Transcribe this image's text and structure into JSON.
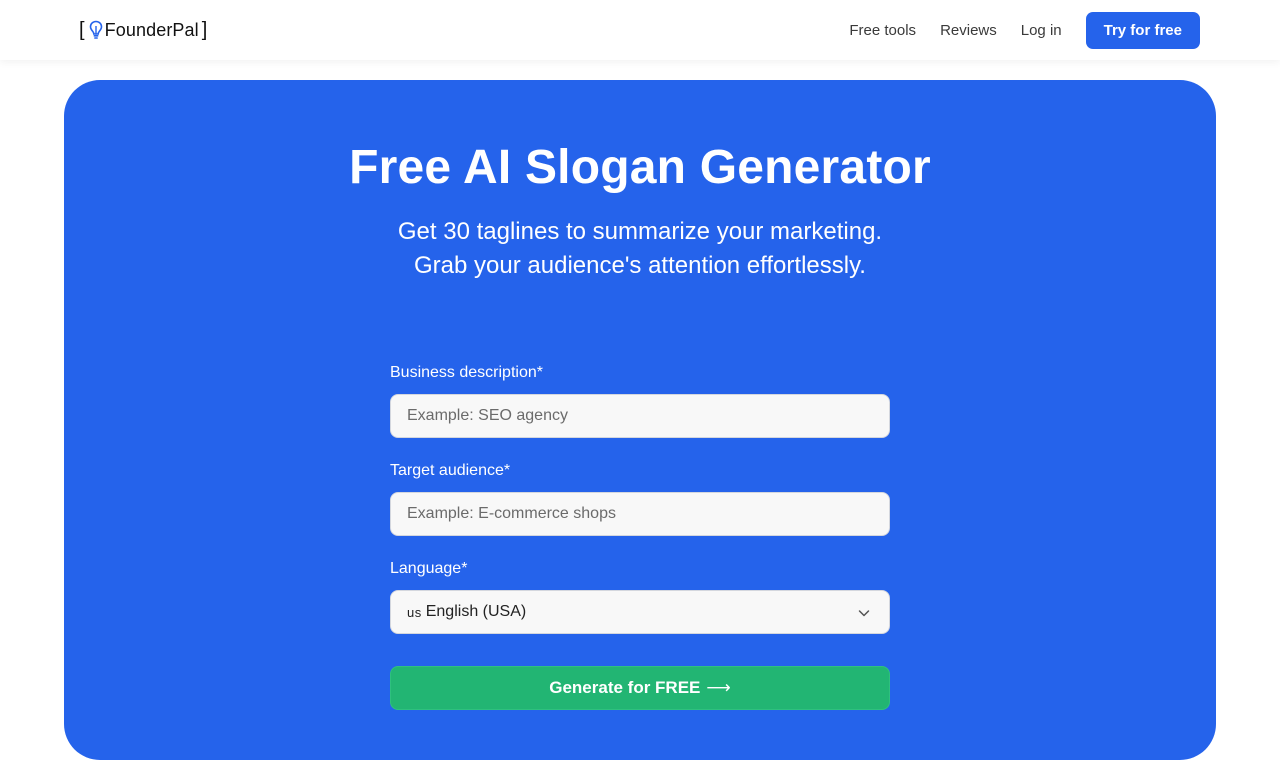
{
  "header": {
    "logo": {
      "bracket_left": "[",
      "name": "FounderPal",
      "bracket_right": "]",
      "icon": "lightbulb-icon"
    },
    "nav": {
      "free_tools": "Free tools",
      "reviews": "Reviews",
      "login": "Log in",
      "cta": "Try for free"
    }
  },
  "hero": {
    "title": "Free AI Slogan Generator",
    "subtitle_line1": "Get 30 taglines to summarize your marketing.",
    "subtitle_line2": "Grab your audience's attention effortlessly."
  },
  "form": {
    "business": {
      "label": "Business description*",
      "placeholder": "Example: SEO agency",
      "value": ""
    },
    "audience": {
      "label": "Target audience*",
      "placeholder": "Example: E-commerce shops",
      "value": ""
    },
    "language": {
      "label": "Language*",
      "flag": "us",
      "selected": "English (USA)",
      "icon": "chevron-down-icon"
    },
    "submit": {
      "label": "Generate for FREE",
      "arrow": "⟶"
    }
  },
  "colors": {
    "brand_blue": "#2563eb",
    "cta_green": "#22b573",
    "white": "#ffffff"
  }
}
